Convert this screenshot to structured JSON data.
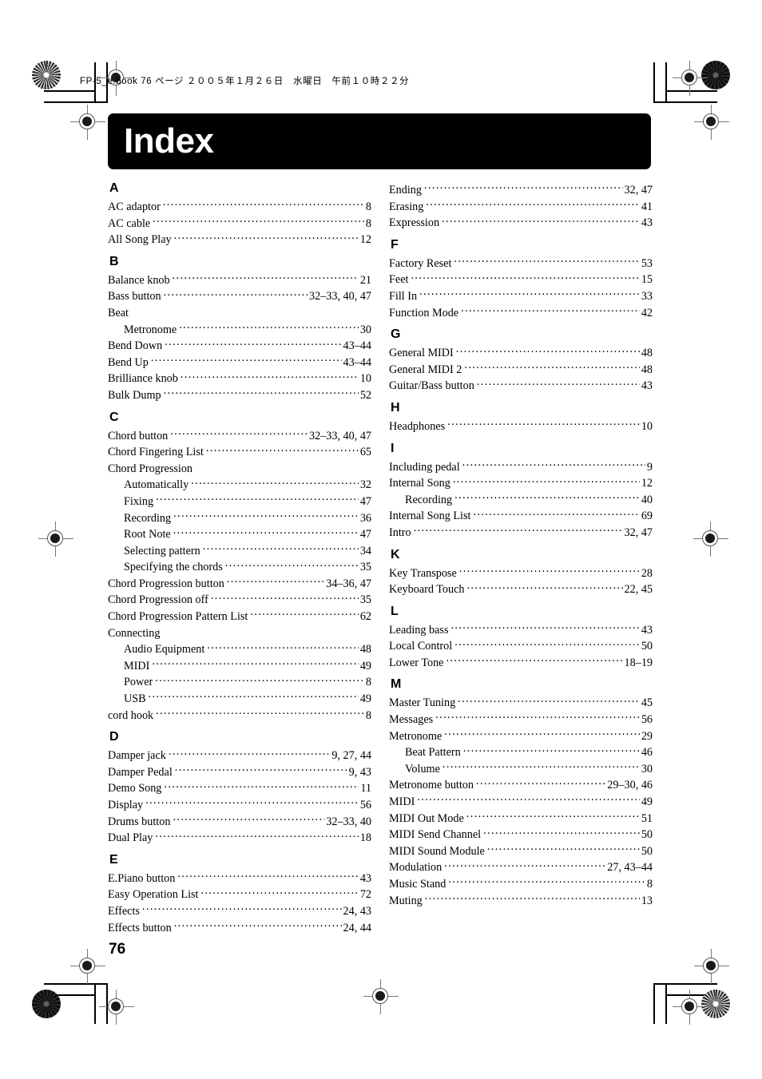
{
  "page": {
    "running_head": "FP-5_e.book  76 ページ  ２００５年１月２６日　水曜日　午前１０時２２分",
    "title": "Index",
    "folio": "76"
  },
  "index": {
    "left_column": [
      {
        "letter": "A",
        "entries": [
          {
            "term": "AC adaptor",
            "pages": "8",
            "sub": false
          },
          {
            "term": "AC cable",
            "pages": "8",
            "sub": false
          },
          {
            "term": "All Song Play",
            "pages": "12",
            "sub": false
          }
        ]
      },
      {
        "letter": "B",
        "entries": [
          {
            "term": "Balance knob",
            "pages": "21",
            "sub": false
          },
          {
            "term": "Bass button",
            "pages": "32–33, 40, 47",
            "sub": false
          },
          {
            "term": "Beat",
            "pages": "",
            "sub": false
          },
          {
            "term": "Metronome",
            "pages": "30",
            "sub": true
          },
          {
            "term": "Bend Down",
            "pages": "43–44",
            "sub": false
          },
          {
            "term": "Bend Up",
            "pages": "43–44",
            "sub": false
          },
          {
            "term": "Brilliance knob",
            "pages": "10",
            "sub": false
          },
          {
            "term": "Bulk Dump",
            "pages": "52",
            "sub": false
          }
        ]
      },
      {
        "letter": "C",
        "entries": [
          {
            "term": "Chord button",
            "pages": "32–33, 40, 47",
            "sub": false
          },
          {
            "term": "Chord Fingering List",
            "pages": "65",
            "sub": false
          },
          {
            "term": "Chord Progression",
            "pages": "",
            "sub": false
          },
          {
            "term": "Automatically",
            "pages": "32",
            "sub": true
          },
          {
            "term": "Fixing",
            "pages": "47",
            "sub": true
          },
          {
            "term": "Recording",
            "pages": "36",
            "sub": true
          },
          {
            "term": "Root Note",
            "pages": "47",
            "sub": true
          },
          {
            "term": "Selecting pattern",
            "pages": "34",
            "sub": true
          },
          {
            "term": "Specifying the chords",
            "pages": "35",
            "sub": true
          },
          {
            "term": "Chord Progression button",
            "pages": "34–36, 47",
            "sub": false
          },
          {
            "term": "Chord Progression off",
            "pages": "35",
            "sub": false
          },
          {
            "term": "Chord Progression Pattern List",
            "pages": "62",
            "sub": false
          },
          {
            "term": "Connecting",
            "pages": "",
            "sub": false
          },
          {
            "term": "Audio Equipment",
            "pages": "48",
            "sub": true
          },
          {
            "term": "MIDI",
            "pages": "49",
            "sub": true
          },
          {
            "term": "Power",
            "pages": "8",
            "sub": true
          },
          {
            "term": "USB",
            "pages": "49",
            "sub": true
          },
          {
            "term": "cord hook",
            "pages": "8",
            "sub": false
          }
        ]
      },
      {
        "letter": "D",
        "entries": [
          {
            "term": "Damper jack",
            "pages": "9, 27, 44",
            "sub": false
          },
          {
            "term": "Damper Pedal",
            "pages": "9, 43",
            "sub": false
          },
          {
            "term": "Demo Song",
            "pages": "11",
            "sub": false
          },
          {
            "term": "Display",
            "pages": "56",
            "sub": false
          },
          {
            "term": "Drums button",
            "pages": "32–33, 40",
            "sub": false
          },
          {
            "term": "Dual Play",
            "pages": "18",
            "sub": false
          }
        ]
      },
      {
        "letter": "E",
        "entries": [
          {
            "term": "E.Piano button",
            "pages": "43",
            "sub": false
          },
          {
            "term": "Easy Operation List",
            "pages": "72",
            "sub": false
          },
          {
            "term": "Effects",
            "pages": "24, 43",
            "sub": false
          },
          {
            "term": "Effects button",
            "pages": "24, 44",
            "sub": false
          }
        ]
      }
    ],
    "right_column": [
      {
        "letter": "",
        "entries": [
          {
            "term": "Ending",
            "pages": "32, 47",
            "sub": false
          },
          {
            "term": "Erasing",
            "pages": "41",
            "sub": false
          },
          {
            "term": "Expression",
            "pages": "43",
            "sub": false
          }
        ]
      },
      {
        "letter": "F",
        "entries": [
          {
            "term": "Factory Reset",
            "pages": "53",
            "sub": false
          },
          {
            "term": "Feet",
            "pages": "15",
            "sub": false
          },
          {
            "term": "Fill In",
            "pages": "33",
            "sub": false
          },
          {
            "term": "Function Mode",
            "pages": "42",
            "sub": false
          }
        ]
      },
      {
        "letter": "G",
        "entries": [
          {
            "term": "General MIDI",
            "pages": "48",
            "sub": false
          },
          {
            "term": "General MIDI 2",
            "pages": "48",
            "sub": false
          },
          {
            "term": "Guitar/Bass button",
            "pages": "43",
            "sub": false
          }
        ]
      },
      {
        "letter": "H",
        "entries": [
          {
            "term": "Headphones",
            "pages": "10",
            "sub": false
          }
        ]
      },
      {
        "letter": "I",
        "entries": [
          {
            "term": "Including pedal",
            "pages": "9",
            "sub": false
          },
          {
            "term": "Internal Song",
            "pages": "12",
            "sub": false
          },
          {
            "term": "Recording",
            "pages": "40",
            "sub": true
          },
          {
            "term": "Internal Song List",
            "pages": "69",
            "sub": false
          },
          {
            "term": "Intro",
            "pages": "32, 47",
            "sub": false
          }
        ]
      },
      {
        "letter": "K",
        "entries": [
          {
            "term": "Key Transpose",
            "pages": "28",
            "sub": false
          },
          {
            "term": "Keyboard Touch",
            "pages": "22, 45",
            "sub": false
          }
        ]
      },
      {
        "letter": "L",
        "entries": [
          {
            "term": "Leading bass",
            "pages": "43",
            "sub": false
          },
          {
            "term": "Local Control",
            "pages": "50",
            "sub": false
          },
          {
            "term": "Lower Tone",
            "pages": "18–19",
            "sub": false
          }
        ]
      },
      {
        "letter": "M",
        "entries": [
          {
            "term": "Master Tuning",
            "pages": "45",
            "sub": false
          },
          {
            "term": "Messages",
            "pages": "56",
            "sub": false
          },
          {
            "term": "Metronome",
            "pages": "29",
            "sub": false
          },
          {
            "term": "Beat Pattern",
            "pages": "46",
            "sub": true
          },
          {
            "term": "Volume",
            "pages": "30",
            "sub": true
          },
          {
            "term": "Metronome button",
            "pages": "29–30, 46",
            "sub": false
          },
          {
            "term": "MIDI",
            "pages": "49",
            "sub": false
          },
          {
            "term": "MIDI Out Mode",
            "pages": "51",
            "sub": false
          },
          {
            "term": "MIDI Send Channel",
            "pages": "50",
            "sub": false
          },
          {
            "term": "MIDI Sound Module",
            "pages": "50",
            "sub": false
          },
          {
            "term": "Modulation",
            "pages": "27, 43–44",
            "sub": false
          },
          {
            "term": "Music Stand",
            "pages": "8",
            "sub": false
          },
          {
            "term": "Muting",
            "pages": "13",
            "sub": false
          }
        ]
      }
    ]
  }
}
